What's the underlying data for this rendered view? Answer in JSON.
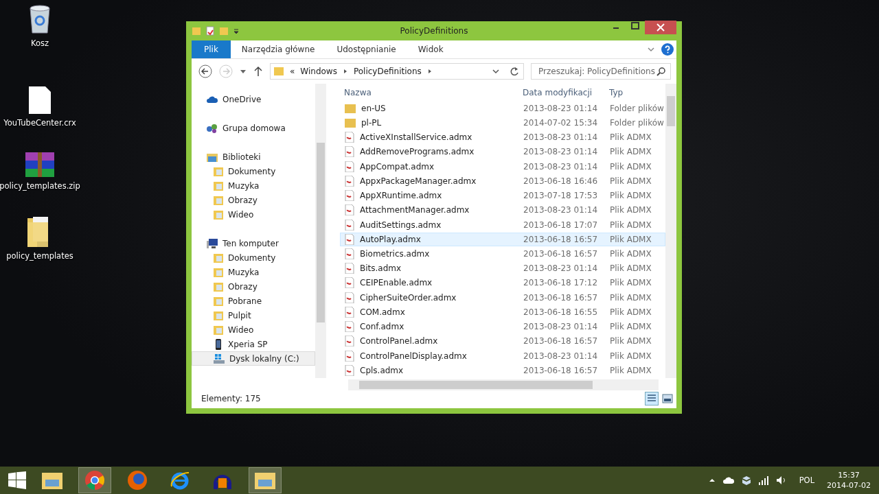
{
  "desktop_icons": [
    {
      "kind": "bin",
      "label": "Kosz"
    },
    {
      "kind": "file",
      "label": "YouTubeCenter.crx"
    },
    {
      "kind": "archive",
      "label": "policy_templates.zip"
    },
    {
      "kind": "folder",
      "label": "policy_templates"
    }
  ],
  "window": {
    "title": "PolicyDefinitions"
  },
  "ribbon_tabs": [
    {
      "label": "Plik",
      "selected": true
    },
    {
      "label": "Narzędzia główne",
      "selected": false
    },
    {
      "label": "Udostępnianie",
      "selected": false
    },
    {
      "label": "Widok",
      "selected": false
    }
  ],
  "address": {
    "overflow": "«",
    "path": [
      "Windows",
      "PolicyDefinitions"
    ]
  },
  "search": {
    "placeholder": "Przeszukaj: PolicyDefinitions"
  },
  "nav": [
    {
      "label": "OneDrive",
      "kind": "cloud",
      "selected": false
    },
    {
      "label": "Grupa domowa",
      "kind": "homegroup",
      "selected": false
    },
    {
      "label": "Biblioteki",
      "kind": "library",
      "selected": false,
      "children": [
        {
          "label": "Dokumenty",
          "kind": "folder",
          "selected": false
        },
        {
          "label": "Muzyka",
          "kind": "folder",
          "selected": false
        },
        {
          "label": "Obrazy",
          "kind": "folder",
          "selected": false
        },
        {
          "label": "Wideo",
          "kind": "folder",
          "selected": false
        }
      ]
    },
    {
      "label": "Ten komputer",
      "kind": "computer",
      "selected": false,
      "children": [
        {
          "label": "Dokumenty",
          "kind": "folder",
          "selected": false
        },
        {
          "label": "Muzyka",
          "kind": "folder",
          "selected": false
        },
        {
          "label": "Obrazy",
          "kind": "folder",
          "selected": false
        },
        {
          "label": "Pobrane",
          "kind": "folder",
          "selected": false
        },
        {
          "label": "Pulpit",
          "kind": "folder",
          "selected": false
        },
        {
          "label": "Wideo",
          "kind": "folder",
          "selected": false
        },
        {
          "label": "Xperia SP",
          "kind": "phone",
          "selected": false
        },
        {
          "label": "Dysk lokalny (C:)",
          "kind": "drive",
          "selected": true
        }
      ]
    }
  ],
  "table": {
    "columns": [
      "Nazwa",
      "Data modyfikacji",
      "Typ"
    ],
    "rows": [
      {
        "kind": "folder",
        "name": "en-US",
        "date": "2013-08-23 01:14",
        "type": "Folder plików",
        "selected": false
      },
      {
        "kind": "folder",
        "name": "pl-PL",
        "date": "2014-07-02 15:34",
        "type": "Folder plików",
        "selected": false
      },
      {
        "kind": "file",
        "name": "ActiveXInstallService.admx",
        "date": "2013-08-23 01:14",
        "type": "Plik ADMX",
        "selected": false
      },
      {
        "kind": "file",
        "name": "AddRemovePrograms.admx",
        "date": "2013-08-23 01:14",
        "type": "Plik ADMX",
        "selected": false
      },
      {
        "kind": "file",
        "name": "AppCompat.admx",
        "date": "2013-08-23 01:14",
        "type": "Plik ADMX",
        "selected": false
      },
      {
        "kind": "file",
        "name": "AppxPackageManager.admx",
        "date": "2013-06-18 16:46",
        "type": "Plik ADMX",
        "selected": false
      },
      {
        "kind": "file",
        "name": "AppXRuntime.admx",
        "date": "2013-07-18 17:53",
        "type": "Plik ADMX",
        "selected": false
      },
      {
        "kind": "file",
        "name": "AttachmentManager.admx",
        "date": "2013-08-23 01:14",
        "type": "Plik ADMX",
        "selected": false
      },
      {
        "kind": "file",
        "name": "AuditSettings.admx",
        "date": "2013-06-18 17:07",
        "type": "Plik ADMX",
        "selected": false
      },
      {
        "kind": "file",
        "name": "AutoPlay.admx",
        "date": "2013-06-18 16:57",
        "type": "Plik ADMX",
        "selected": true
      },
      {
        "kind": "file",
        "name": "Biometrics.admx",
        "date": "2013-06-18 16:57",
        "type": "Plik ADMX",
        "selected": false
      },
      {
        "kind": "file",
        "name": "Bits.admx",
        "date": "2013-08-23 01:14",
        "type": "Plik ADMX",
        "selected": false
      },
      {
        "kind": "file",
        "name": "CEIPEnable.admx",
        "date": "2013-06-18 17:12",
        "type": "Plik ADMX",
        "selected": false
      },
      {
        "kind": "file",
        "name": "CipherSuiteOrder.admx",
        "date": "2013-06-18 16:57",
        "type": "Plik ADMX",
        "selected": false
      },
      {
        "kind": "file",
        "name": "COM.admx",
        "date": "2013-06-18 16:55",
        "type": "Plik ADMX",
        "selected": false
      },
      {
        "kind": "file",
        "name": "Conf.admx",
        "date": "2013-08-23 01:14",
        "type": "Plik ADMX",
        "selected": false
      },
      {
        "kind": "file",
        "name": "ControlPanel.admx",
        "date": "2013-06-18 16:57",
        "type": "Plik ADMX",
        "selected": false
      },
      {
        "kind": "file",
        "name": "ControlPanelDisplay.admx",
        "date": "2013-08-23 01:14",
        "type": "Plik ADMX",
        "selected": false
      },
      {
        "kind": "file",
        "name": "Cpls.admx",
        "date": "2013-06-18 16:57",
        "type": "Plik ADMX",
        "selected": false
      }
    ]
  },
  "status_bar": {
    "count": "Elementy: 175"
  },
  "taskbar": {
    "apps": [
      {
        "kind": "explorer",
        "selected": false
      },
      {
        "kind": "chrome",
        "selected": true
      },
      {
        "kind": "firefox",
        "selected": false
      },
      {
        "kind": "ie",
        "selected": false
      },
      {
        "kind": "audio",
        "selected": false
      },
      {
        "kind": "explorer",
        "selected": true
      }
    ],
    "language": "POL",
    "time": "15:37",
    "date": "2014-07-02"
  }
}
